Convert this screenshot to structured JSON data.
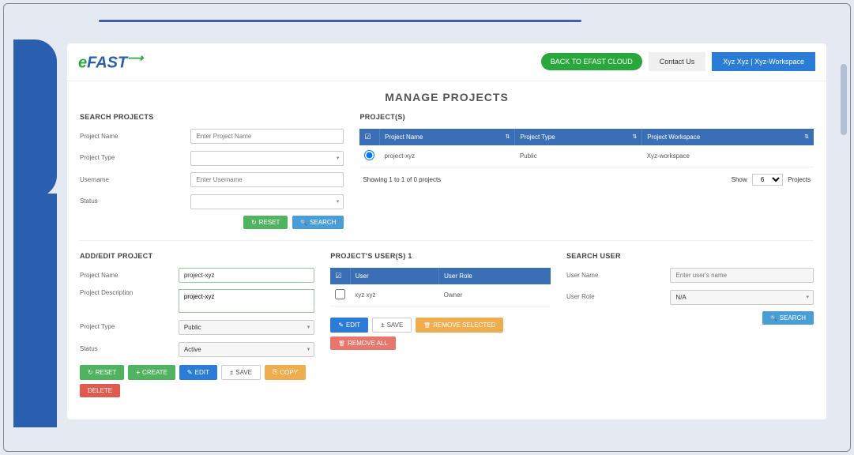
{
  "header": {
    "logo_e": "e",
    "logo_fast": "FAST",
    "back_label": "BACK TO EFAST CLOUD",
    "contact_label": "Contact Us",
    "user_label": "Xyz Xyz | Xyz-Workspace"
  },
  "page_title": "MANAGE PROJECTS",
  "search_projects": {
    "title": "SEARCH PROJECTS",
    "project_name_label": "Project Name",
    "project_name_placeholder": "Enter Project Name",
    "project_type_label": "Project Type",
    "username_label": "Username",
    "username_placeholder": "Enter Username",
    "status_label": "Status",
    "reset_label": "RESET",
    "search_label": "SEARCH"
  },
  "projects": {
    "title": "PROJECT(S)",
    "col_name": "Project Name",
    "col_type": "Project Type",
    "col_workspace": "Project Workspace",
    "rows": [
      {
        "name": "project-xyz",
        "type": "Public",
        "workspace": "Xyz-workspace"
      }
    ],
    "footer_showing": "Showing 1 to 1 of 0 projects",
    "footer_show": "Show",
    "footer_count": "6",
    "footer_projects": "Projects"
  },
  "add_edit": {
    "title": "ADD/EDIT PROJECT",
    "name_label": "Project Name",
    "name_value": "project-xyz",
    "desc_label": "Project Description",
    "desc_value": "project-xyz",
    "type_label": "Project Type",
    "type_value": "Public",
    "status_label": "Status",
    "status_value": "Active",
    "reset_btn": "RESET",
    "create_btn": "CREATE",
    "edit_btn": "EDIT",
    "save_btn": "SAVE",
    "copy_btn": "COPY",
    "delete_btn": "DELETE"
  },
  "project_users": {
    "title": "PROJECT'S USER(S) 1",
    "col_user": "User",
    "col_role": "User Role",
    "rows": [
      {
        "user": "xyz xyz",
        "role": "Owner"
      }
    ],
    "edit_btn": "EDIT",
    "save_btn": "SAVE",
    "remove_sel_btn": "REMOVE SELECTED",
    "remove_all_btn": "REMOVE ALL"
  },
  "search_user": {
    "title": "SEARCH USER",
    "name_label": "User Name",
    "name_placeholder": "Enter user's name",
    "role_label": "User Role",
    "role_value": "N/A",
    "search_btn": "SEARCH"
  }
}
